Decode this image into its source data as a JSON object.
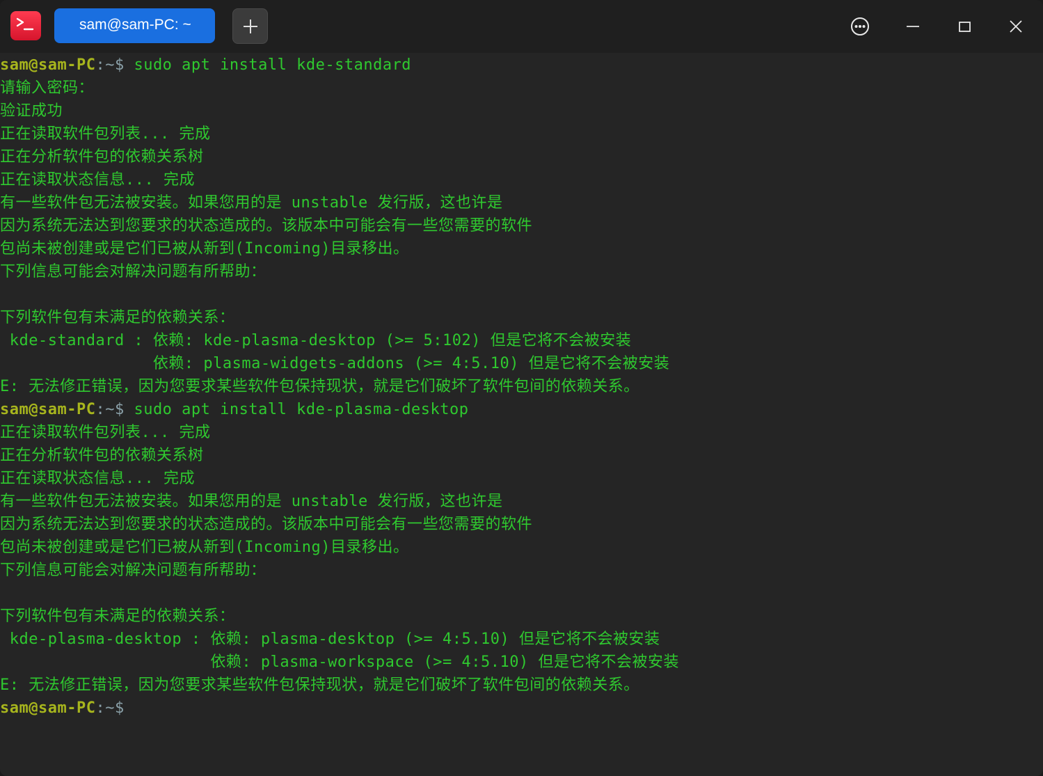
{
  "window": {
    "tab_title": "sam@sam-PC: ~",
    "colors": {
      "tab_active": "#1a6fe0",
      "titlebar": "#1f1f1f",
      "terminal_bg": "#252525",
      "output_text": "#2fc92f",
      "prompt_user": "#a7b51d",
      "prompt_path": "#8aa0a8",
      "app_icon": "#e8213a"
    },
    "icons": {
      "app": "terminal-icon",
      "tab_close": "close-icon",
      "new_tab": "plus-icon",
      "menu": "more-options-icon",
      "minimize": "minimize-icon",
      "maximize": "maximize-icon",
      "close": "close-window-icon"
    }
  },
  "terminal": {
    "prompt_user": "sam@sam-PC",
    "prompt_path": ":~$",
    "lines": [
      {
        "type": "prompt",
        "cmd": " sudo apt install kde-standard"
      },
      {
        "type": "output",
        "text": "请输入密码："
      },
      {
        "type": "output",
        "text": "验证成功"
      },
      {
        "type": "output",
        "text": "正在读取软件包列表... 完成"
      },
      {
        "type": "output",
        "text": "正在分析软件包的依赖关系树"
      },
      {
        "type": "output",
        "text": "正在读取状态信息... 完成"
      },
      {
        "type": "output",
        "text": "有一些软件包无法被安装。如果您用的是 unstable 发行版，这也许是"
      },
      {
        "type": "output",
        "text": "因为系统无法达到您要求的状态造成的。该版本中可能会有一些您需要的软件"
      },
      {
        "type": "output",
        "text": "包尚未被创建或是它们已被从新到(Incoming)目录移出。"
      },
      {
        "type": "output",
        "text": "下列信息可能会对解决问题有所帮助："
      },
      {
        "type": "output",
        "text": ""
      },
      {
        "type": "output",
        "text": "下列软件包有未满足的依赖关系："
      },
      {
        "type": "output",
        "text": " kde-standard : 依赖: kde-plasma-desktop (>= 5:102) 但是它将不会被安装"
      },
      {
        "type": "output",
        "text": "                依赖: plasma-widgets-addons (>= 4:5.10) 但是它将不会被安装"
      },
      {
        "type": "output",
        "text": "E: 无法修正错误，因为您要求某些软件包保持现状，就是它们破坏了软件包间的依赖关系。"
      },
      {
        "type": "prompt",
        "cmd": " sudo apt install kde-plasma-desktop"
      },
      {
        "type": "output",
        "text": "正在读取软件包列表... 完成"
      },
      {
        "type": "output",
        "text": "正在分析软件包的依赖关系树"
      },
      {
        "type": "output",
        "text": "正在读取状态信息... 完成"
      },
      {
        "type": "output",
        "text": "有一些软件包无法被安装。如果您用的是 unstable 发行版，这也许是"
      },
      {
        "type": "output",
        "text": "因为系统无法达到您要求的状态造成的。该版本中可能会有一些您需要的软件"
      },
      {
        "type": "output",
        "text": "包尚未被创建或是它们已被从新到(Incoming)目录移出。"
      },
      {
        "type": "output",
        "text": "下列信息可能会对解决问题有所帮助："
      },
      {
        "type": "output",
        "text": ""
      },
      {
        "type": "output",
        "text": "下列软件包有未满足的依赖关系："
      },
      {
        "type": "output",
        "text": " kde-plasma-desktop : 依赖: plasma-desktop (>= 4:5.10) 但是它将不会被安装"
      },
      {
        "type": "output",
        "text": "                      依赖: plasma-workspace (>= 4:5.10) 但是它将不会被安装"
      },
      {
        "type": "output",
        "text": "E: 无法修正错误，因为您要求某些软件包保持现状，就是它们破坏了软件包间的依赖关系。"
      },
      {
        "type": "prompt",
        "cmd": ""
      }
    ]
  }
}
